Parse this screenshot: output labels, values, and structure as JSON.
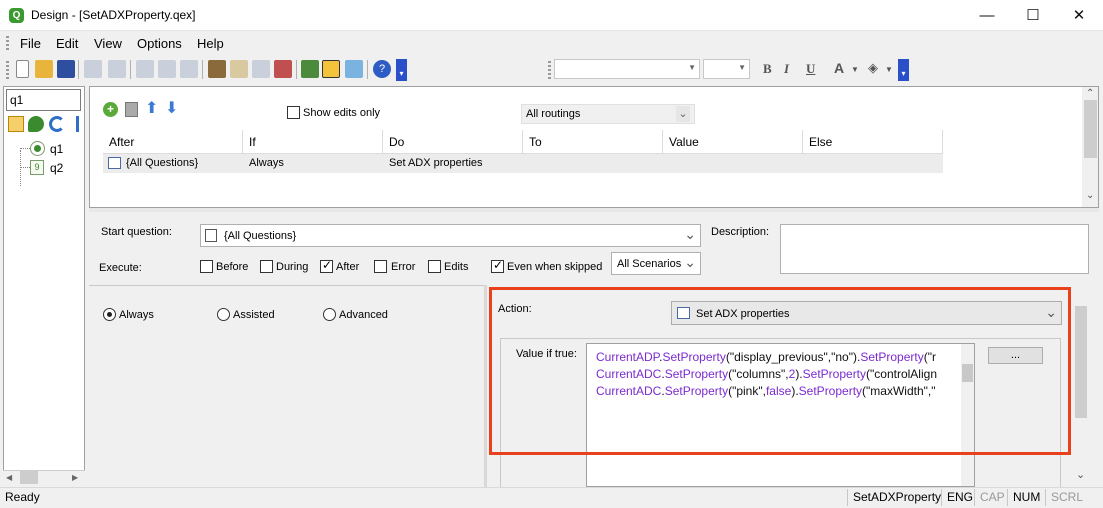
{
  "window": {
    "title": "Design - [SetADXProperty.qex]",
    "minimize": "—",
    "maximize": "☐",
    "close": "✕"
  },
  "menu": [
    "File",
    "Edit",
    "View",
    "Options",
    "Help"
  ],
  "left": {
    "search_value": "q1",
    "tree": [
      {
        "label": "q1"
      },
      {
        "label": "q2"
      }
    ]
  },
  "routing": {
    "show_edits_only": "Show edits only",
    "routings_select": "All routings",
    "columns": [
      "After",
      "If",
      "Do",
      "To",
      "Value",
      "Else"
    ],
    "rows": [
      {
        "after": "{All Questions}",
        "if": "Always",
        "do": "Set ADX properties",
        "to": "",
        "value": "",
        "else": ""
      }
    ]
  },
  "details": {
    "start_question_label": "Start question:",
    "start_question_value": "{All Questions}",
    "description_label": "Description:",
    "execute_label": "Execute:",
    "execute_options": [
      {
        "label": "Before",
        "checked": false
      },
      {
        "label": "During",
        "checked": false
      },
      {
        "label": "After",
        "checked": true
      },
      {
        "label": "Error",
        "checked": false
      },
      {
        "label": "Edits",
        "checked": false
      },
      {
        "label": "Even when skipped",
        "checked": true
      }
    ],
    "scenarios_select": "All Scenarios"
  },
  "mode": {
    "options": [
      "Always",
      "Assisted",
      "Advanced"
    ],
    "selected": "Always"
  },
  "action": {
    "label": "Action:",
    "value": "Set ADX properties",
    "value_if_true_label": "Value if true:",
    "ellipsis_button": "...",
    "code_lines": [
      [
        [
          "p",
          "CurrentADP"
        ],
        [
          "b",
          "."
        ],
        [
          "p",
          "SetProperty"
        ],
        [
          "b",
          "("
        ],
        [
          "b",
          "\"display_previous\""
        ],
        [
          "b",
          ","
        ],
        [
          "b",
          "\"no\""
        ],
        [
          "b",
          ")."
        ],
        [
          "p",
          "SetProperty"
        ],
        [
          "b",
          "(\"r"
        ]
      ],
      [
        [
          "p",
          "CurrentADC"
        ],
        [
          "b",
          "."
        ],
        [
          "p",
          "SetProperty"
        ],
        [
          "b",
          "("
        ],
        [
          "b",
          "\"columns\""
        ],
        [
          "b",
          ","
        ],
        [
          "p",
          "2"
        ],
        [
          "b",
          ")."
        ],
        [
          "p",
          "SetProperty"
        ],
        [
          "b",
          "(\"controlAlign"
        ]
      ],
      [
        [
          "p",
          "CurrentADC"
        ],
        [
          "b",
          "."
        ],
        [
          "p",
          "SetProperty"
        ],
        [
          "b",
          "("
        ],
        [
          "b",
          "\"pink\""
        ],
        [
          "b",
          ","
        ],
        [
          "p",
          "false"
        ],
        [
          "b",
          ")."
        ],
        [
          "p",
          "SetProperty"
        ],
        [
          "b",
          "(\"maxWidth\",\""
        ]
      ]
    ],
    "highlight_color": "#e8411c"
  },
  "status": {
    "text": "Ready",
    "cells": [
      "SetADXProperty",
      "ENG",
      "CAP",
      "NUM",
      "SCRL"
    ]
  }
}
